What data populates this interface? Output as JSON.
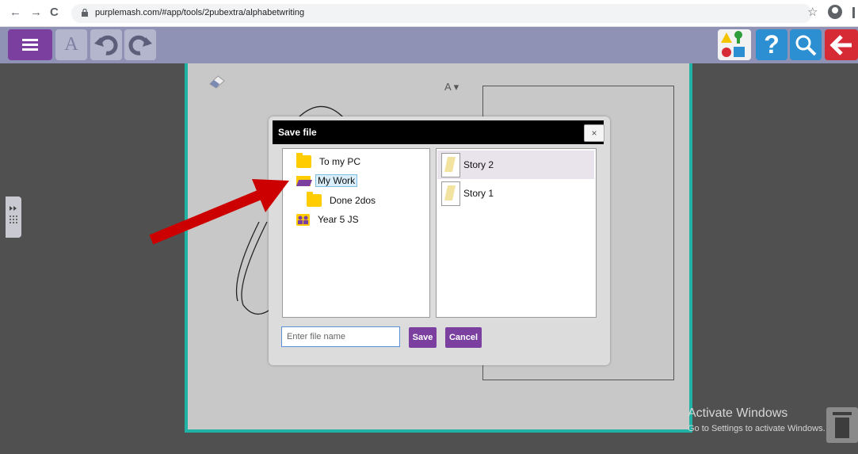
{
  "browser": {
    "url": "purplemash.com/#app/tools/2pubextra/alphabetwriting",
    "back_glyph": "←",
    "forward_glyph": "→",
    "reload_glyph": "C",
    "star_glyph": "☆"
  },
  "toolbar": {
    "font_label": "A",
    "help_label": "?",
    "icons": [
      "menu-icon",
      "font-icon",
      "undo-icon",
      "redo-icon",
      "shapes-icon",
      "help-icon",
      "search-icon",
      "back-arrow-icon"
    ]
  },
  "canvas": {
    "font_size_label": "A ▾"
  },
  "dialog": {
    "title": "Save file",
    "close_label": "×",
    "tree": [
      {
        "label": "To my PC",
        "icon": "folder-icon"
      },
      {
        "label": "My Work",
        "icon": "open-folder-icon",
        "selected": true
      },
      {
        "label": "Done 2dos",
        "icon": "folder-icon"
      },
      {
        "label": "Year 5 JS",
        "icon": "people-icon"
      }
    ],
    "files": [
      {
        "label": "Story 2",
        "selected": true
      },
      {
        "label": "Story 1",
        "selected": false
      }
    ],
    "filename_placeholder": "Enter file name",
    "save_label": "Save",
    "cancel_label": "Cancel"
  },
  "watermark": {
    "line1": "Activate Windows",
    "line2": "Go to Settings to activate Windows."
  },
  "colors": {
    "purple": "#7b3fa0",
    "toolbar": "#8f92b4",
    "canvas_border": "#21b2a6",
    "help_blue": "#2c8fd1",
    "back_red": "#d62a35",
    "arrow_red": "#cc0000"
  }
}
